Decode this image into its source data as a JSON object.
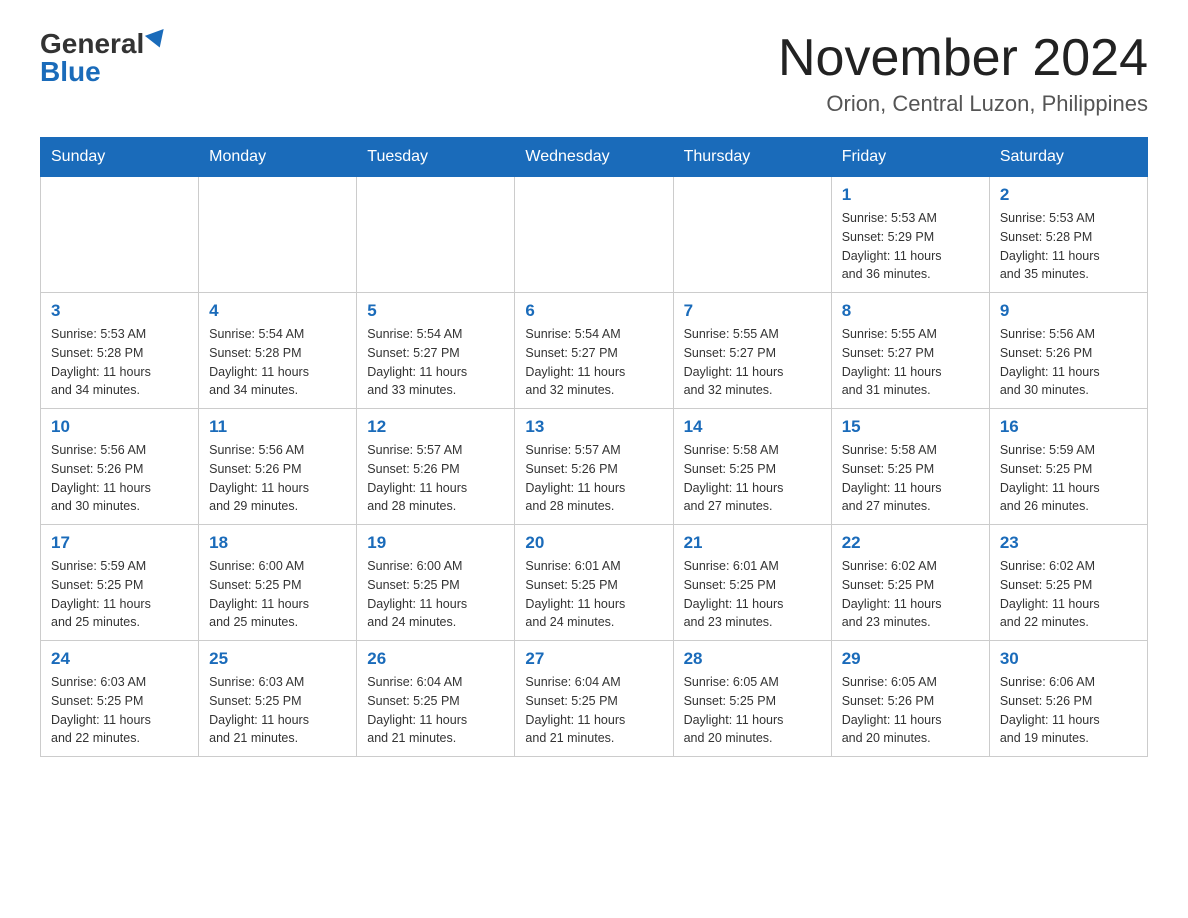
{
  "logo": {
    "general": "General",
    "blue": "Blue"
  },
  "header": {
    "title": "November 2024",
    "subtitle": "Orion, Central Luzon, Philippines"
  },
  "weekdays": [
    "Sunday",
    "Monday",
    "Tuesday",
    "Wednesday",
    "Thursday",
    "Friday",
    "Saturday"
  ],
  "weeks": [
    [
      {
        "day": "",
        "info": ""
      },
      {
        "day": "",
        "info": ""
      },
      {
        "day": "",
        "info": ""
      },
      {
        "day": "",
        "info": ""
      },
      {
        "day": "",
        "info": ""
      },
      {
        "day": "1",
        "info": "Sunrise: 5:53 AM\nSunset: 5:29 PM\nDaylight: 11 hours\nand 36 minutes."
      },
      {
        "day": "2",
        "info": "Sunrise: 5:53 AM\nSunset: 5:28 PM\nDaylight: 11 hours\nand 35 minutes."
      }
    ],
    [
      {
        "day": "3",
        "info": "Sunrise: 5:53 AM\nSunset: 5:28 PM\nDaylight: 11 hours\nand 34 minutes."
      },
      {
        "day": "4",
        "info": "Sunrise: 5:54 AM\nSunset: 5:28 PM\nDaylight: 11 hours\nand 34 minutes."
      },
      {
        "day": "5",
        "info": "Sunrise: 5:54 AM\nSunset: 5:27 PM\nDaylight: 11 hours\nand 33 minutes."
      },
      {
        "day": "6",
        "info": "Sunrise: 5:54 AM\nSunset: 5:27 PM\nDaylight: 11 hours\nand 32 minutes."
      },
      {
        "day": "7",
        "info": "Sunrise: 5:55 AM\nSunset: 5:27 PM\nDaylight: 11 hours\nand 32 minutes."
      },
      {
        "day": "8",
        "info": "Sunrise: 5:55 AM\nSunset: 5:27 PM\nDaylight: 11 hours\nand 31 minutes."
      },
      {
        "day": "9",
        "info": "Sunrise: 5:56 AM\nSunset: 5:26 PM\nDaylight: 11 hours\nand 30 minutes."
      }
    ],
    [
      {
        "day": "10",
        "info": "Sunrise: 5:56 AM\nSunset: 5:26 PM\nDaylight: 11 hours\nand 30 minutes."
      },
      {
        "day": "11",
        "info": "Sunrise: 5:56 AM\nSunset: 5:26 PM\nDaylight: 11 hours\nand 29 minutes."
      },
      {
        "day": "12",
        "info": "Sunrise: 5:57 AM\nSunset: 5:26 PM\nDaylight: 11 hours\nand 28 minutes."
      },
      {
        "day": "13",
        "info": "Sunrise: 5:57 AM\nSunset: 5:26 PM\nDaylight: 11 hours\nand 28 minutes."
      },
      {
        "day": "14",
        "info": "Sunrise: 5:58 AM\nSunset: 5:25 PM\nDaylight: 11 hours\nand 27 minutes."
      },
      {
        "day": "15",
        "info": "Sunrise: 5:58 AM\nSunset: 5:25 PM\nDaylight: 11 hours\nand 27 minutes."
      },
      {
        "day": "16",
        "info": "Sunrise: 5:59 AM\nSunset: 5:25 PM\nDaylight: 11 hours\nand 26 minutes."
      }
    ],
    [
      {
        "day": "17",
        "info": "Sunrise: 5:59 AM\nSunset: 5:25 PM\nDaylight: 11 hours\nand 25 minutes."
      },
      {
        "day": "18",
        "info": "Sunrise: 6:00 AM\nSunset: 5:25 PM\nDaylight: 11 hours\nand 25 minutes."
      },
      {
        "day": "19",
        "info": "Sunrise: 6:00 AM\nSunset: 5:25 PM\nDaylight: 11 hours\nand 24 minutes."
      },
      {
        "day": "20",
        "info": "Sunrise: 6:01 AM\nSunset: 5:25 PM\nDaylight: 11 hours\nand 24 minutes."
      },
      {
        "day": "21",
        "info": "Sunrise: 6:01 AM\nSunset: 5:25 PM\nDaylight: 11 hours\nand 23 minutes."
      },
      {
        "day": "22",
        "info": "Sunrise: 6:02 AM\nSunset: 5:25 PM\nDaylight: 11 hours\nand 23 minutes."
      },
      {
        "day": "23",
        "info": "Sunrise: 6:02 AM\nSunset: 5:25 PM\nDaylight: 11 hours\nand 22 minutes."
      }
    ],
    [
      {
        "day": "24",
        "info": "Sunrise: 6:03 AM\nSunset: 5:25 PM\nDaylight: 11 hours\nand 22 minutes."
      },
      {
        "day": "25",
        "info": "Sunrise: 6:03 AM\nSunset: 5:25 PM\nDaylight: 11 hours\nand 21 minutes."
      },
      {
        "day": "26",
        "info": "Sunrise: 6:04 AM\nSunset: 5:25 PM\nDaylight: 11 hours\nand 21 minutes."
      },
      {
        "day": "27",
        "info": "Sunrise: 6:04 AM\nSunset: 5:25 PM\nDaylight: 11 hours\nand 21 minutes."
      },
      {
        "day": "28",
        "info": "Sunrise: 6:05 AM\nSunset: 5:25 PM\nDaylight: 11 hours\nand 20 minutes."
      },
      {
        "day": "29",
        "info": "Sunrise: 6:05 AM\nSunset: 5:26 PM\nDaylight: 11 hours\nand 20 minutes."
      },
      {
        "day": "30",
        "info": "Sunrise: 6:06 AM\nSunset: 5:26 PM\nDaylight: 11 hours\nand 19 minutes."
      }
    ]
  ]
}
